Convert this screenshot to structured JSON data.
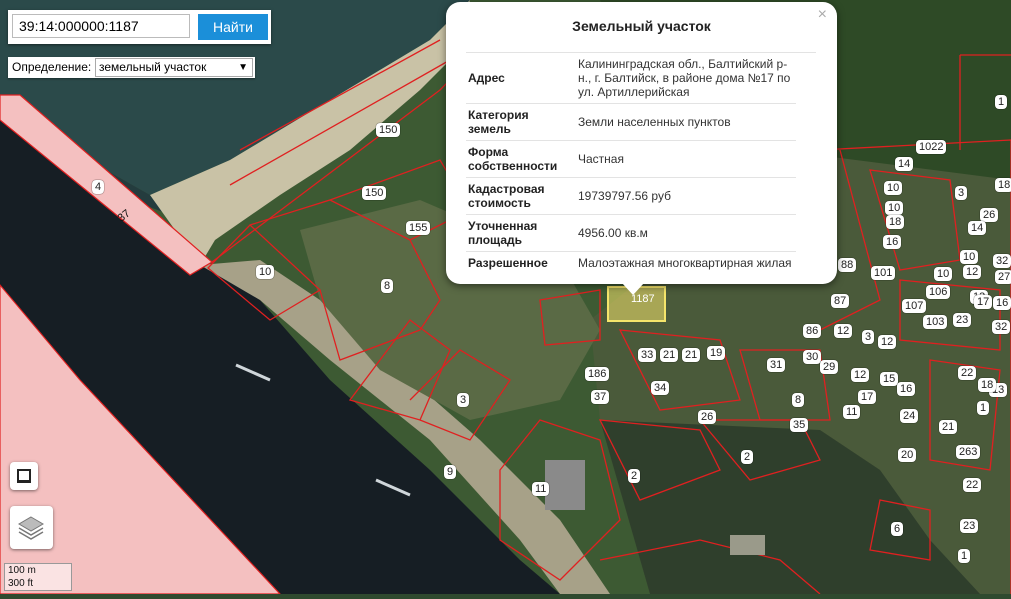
{
  "search": {
    "value": "39:14:000000:1187",
    "button_label": "Найти"
  },
  "definition": {
    "label": "Определение:",
    "selected": "земельный участок"
  },
  "popup": {
    "title": "Земельный участок",
    "close": "×",
    "rows": [
      {
        "key": "Адрес",
        "value": "Калининградская обл., Балтийский р-н., г. Балтийск, в районе дома №17 по ул. Артиллерийская"
      },
      {
        "key": "Категория земель",
        "value": "Земли населенных пунктов"
      },
      {
        "key": "Форма собственности",
        "value": "Частная"
      },
      {
        "key": "Кадастровая стоимость",
        "value": "19739797.56 руб"
      },
      {
        "key": "Уточненная площадь",
        "value": "4956.00 кв.м"
      },
      {
        "key": "Разрешенное использование",
        "value": "Малоэтажная многоквартирная жилая застройка"
      }
    ]
  },
  "scale": {
    "metric": "100 m",
    "imperial": "300 ft"
  },
  "road_label": "37",
  "parcel_labels": [
    "4",
    "150",
    "150",
    "155",
    "10",
    "8",
    "3",
    "9",
    "11",
    "2",
    "1187",
    "33",
    "21",
    "21",
    "19",
    "34",
    "37",
    "26",
    "186",
    "31",
    "8",
    "35",
    "30",
    "29",
    "12",
    "11",
    "17",
    "2",
    "6",
    "22",
    "23",
    "1",
    "1",
    "1022",
    "14",
    "10",
    "10",
    "3",
    "26",
    "14",
    "18",
    "10",
    "12",
    "18",
    "16",
    "32",
    "27",
    "32",
    "13",
    "23",
    "88",
    "101",
    "107",
    "106",
    "103",
    "10",
    "17",
    "16",
    "86",
    "87",
    "12",
    "3",
    "12",
    "15",
    "16",
    "24",
    "20",
    "21",
    "263",
    "22",
    "13",
    "18",
    "1"
  ],
  "colors": {
    "parcel_border": "#e02020",
    "selected_fill": "#f5e56b",
    "highway_fill": "#f4c0c0",
    "sea": "#1f3a3f",
    "water_dark": "#141c22"
  }
}
